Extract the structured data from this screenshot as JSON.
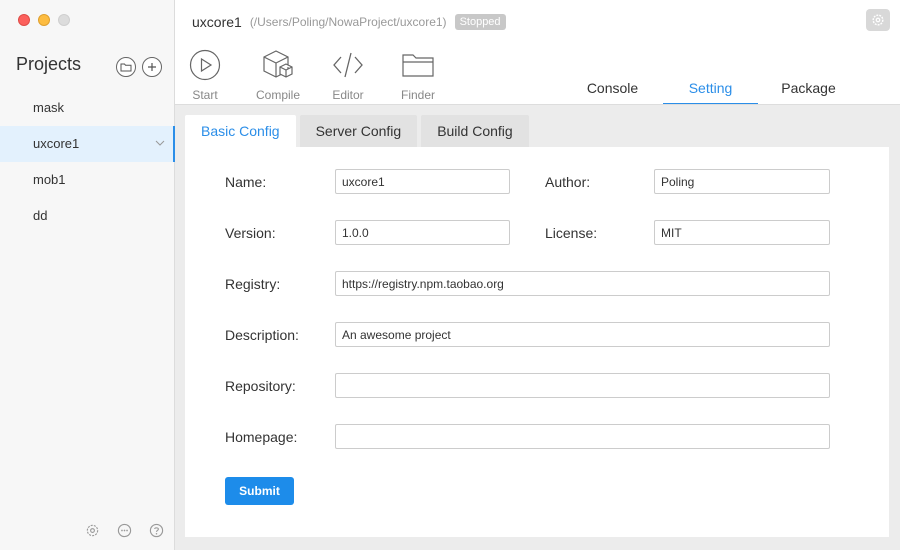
{
  "sidebar": {
    "title": "Projects",
    "projects": [
      {
        "name": "mask"
      },
      {
        "name": "uxcore1",
        "active": true
      },
      {
        "name": "mob1"
      },
      {
        "name": "dd"
      }
    ]
  },
  "header": {
    "project_name": "uxcore1",
    "project_path": "(/Users/Poling/NowaProject/uxcore1)",
    "status": "Stopped"
  },
  "toolbar": {
    "start": "Start",
    "compile": "Compile",
    "editor": "Editor",
    "finder": "Finder"
  },
  "main_tabs": {
    "console": "Console",
    "setting": "Setting",
    "package": "Package",
    "active": "Setting"
  },
  "sub_tabs": {
    "basic": "Basic Config",
    "server": "Server Config",
    "build": "Build Config",
    "active": "Basic Config"
  },
  "form": {
    "name_label": "Name:",
    "name_value": "uxcore1",
    "author_label": "Author:",
    "author_value": "Poling",
    "version_label": "Version:",
    "version_value": "1.0.0",
    "license_label": "License:",
    "license_value": "MIT",
    "registry_label": "Registry:",
    "registry_value": "https://registry.npm.taobao.org",
    "description_label": "Description:",
    "description_value": "An awesome project",
    "repository_label": "Repository:",
    "repository_value": "",
    "homepage_label": "Homepage:",
    "homepage_value": "",
    "submit_label": "Submit"
  },
  "colors": {
    "accent": "#2b8ee8",
    "active_row": "#e3f1fd",
    "submit": "#1d8cea",
    "status_badge": "#c8c8c8"
  },
  "icons": {
    "folder_button": "folder-icon",
    "add_button": "plus-icon",
    "start": "play-icon",
    "compile": "cube-icon",
    "editor": "code-icon",
    "finder": "folder-icon",
    "settings": "gear-icon",
    "feedback": "chat-icon",
    "help": "question-icon"
  }
}
